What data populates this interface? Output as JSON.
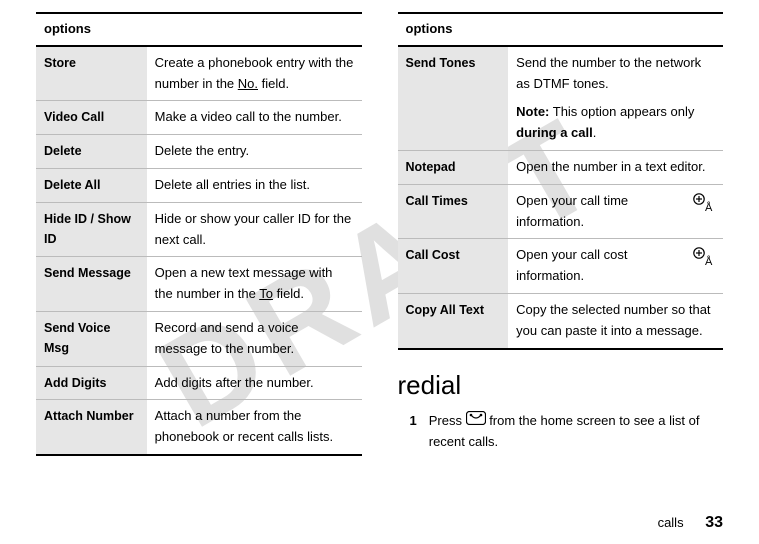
{
  "watermark": "DRAFT",
  "left": {
    "header": "options",
    "rows": [
      {
        "label": "Store",
        "desc_pre": "Create a phonebook entry with the number in the ",
        "desc_ul": "No.",
        "desc_post": " field."
      },
      {
        "label": "Video Call",
        "desc": "Make a video call to the number."
      },
      {
        "label": "Delete",
        "desc": "Delete the entry."
      },
      {
        "label": "Delete All",
        "desc": "Delete all entries in the list."
      },
      {
        "label": "Hide ID / Show ID",
        "desc": "Hide or show your caller ID for the next call."
      },
      {
        "label": "Send Message",
        "desc_pre": "Open a new text message with the number in the ",
        "desc_ul": "To",
        "desc_post": " field."
      },
      {
        "label": "Send Voice Msg",
        "desc": "Record and send a voice message to the number."
      },
      {
        "label": "Add Digits",
        "desc": "Add digits after the number."
      },
      {
        "label": "Attach Number",
        "desc": "Attach a number from the phonebook or recent calls lists."
      }
    ]
  },
  "right": {
    "header": "options",
    "rows": [
      {
        "label": "Send Tones",
        "desc": "Send the number to the network as DTMF tones.",
        "note_label": "Note:",
        "note_pre": " This option appears only ",
        "note_bold": "during a call",
        "note_post": "."
      },
      {
        "label": "Notepad",
        "desc": "Open the number in a text editor."
      },
      {
        "label": "Call Times",
        "desc": "Open your call time information.",
        "icon": true
      },
      {
        "label": "Call Cost",
        "desc": "Open your call cost information.",
        "icon": true
      },
      {
        "label": "Copy All Text",
        "desc": "Copy the selected number so that you can paste it into a message."
      }
    ]
  },
  "section_title": "redial",
  "step": {
    "num": "1",
    "pre": "Press ",
    "post": " from the home screen to see a list of recent calls."
  },
  "footer_label": "calls",
  "footer_page": "33"
}
